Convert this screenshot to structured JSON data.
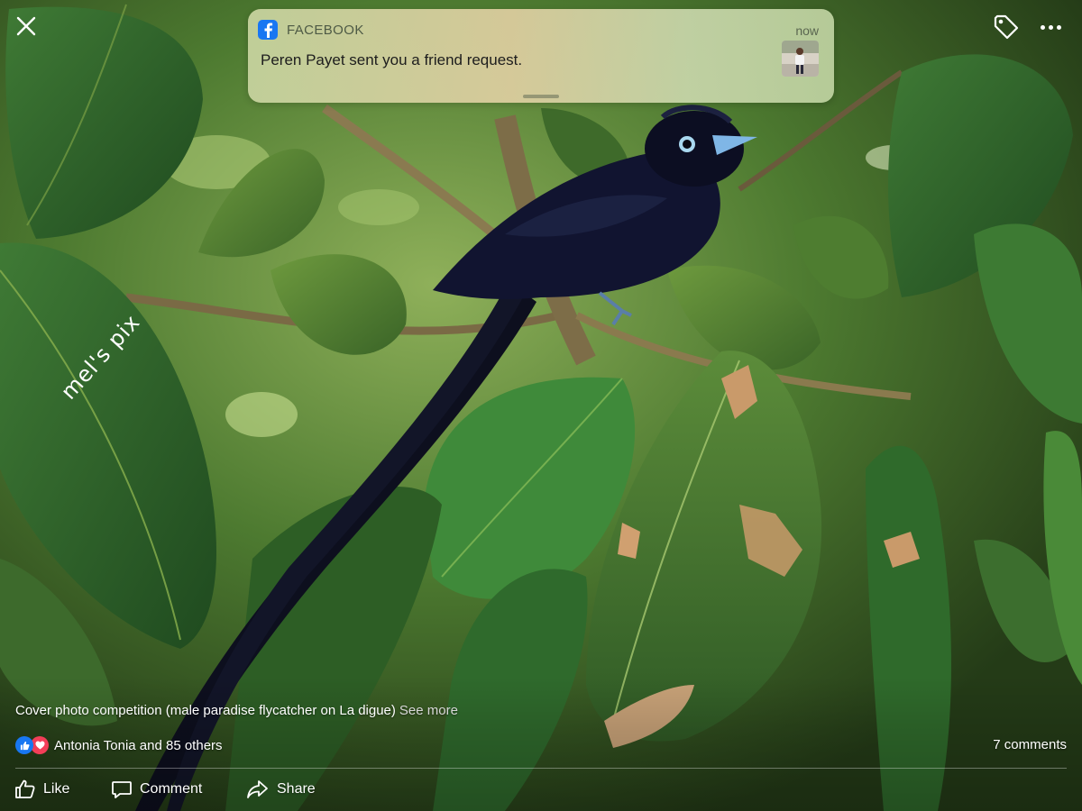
{
  "notification": {
    "app_name": "FACEBOOK",
    "time": "now",
    "message": "Peren Payet sent you a friend request."
  },
  "photo": {
    "watermark": "mel's pix"
  },
  "post": {
    "caption": "Cover photo competition (male paradise flycatcher on La digue)",
    "see_more": "See more",
    "reactors": "Antonia Tonia and 85 others",
    "comments": "7 comments"
  },
  "actions": {
    "like": "Like",
    "comment": "Comment",
    "share": "Share"
  },
  "icons": {
    "close": "close-icon",
    "tag": "tag-icon",
    "more": "more-icon",
    "facebook": "facebook-icon",
    "like_reaction": "like-reaction-icon",
    "love_reaction": "love-reaction-icon"
  },
  "colors": {
    "facebook_blue": "#1877f2",
    "love_red": "#f33e58",
    "bird_beak": "#7fb6e6"
  }
}
